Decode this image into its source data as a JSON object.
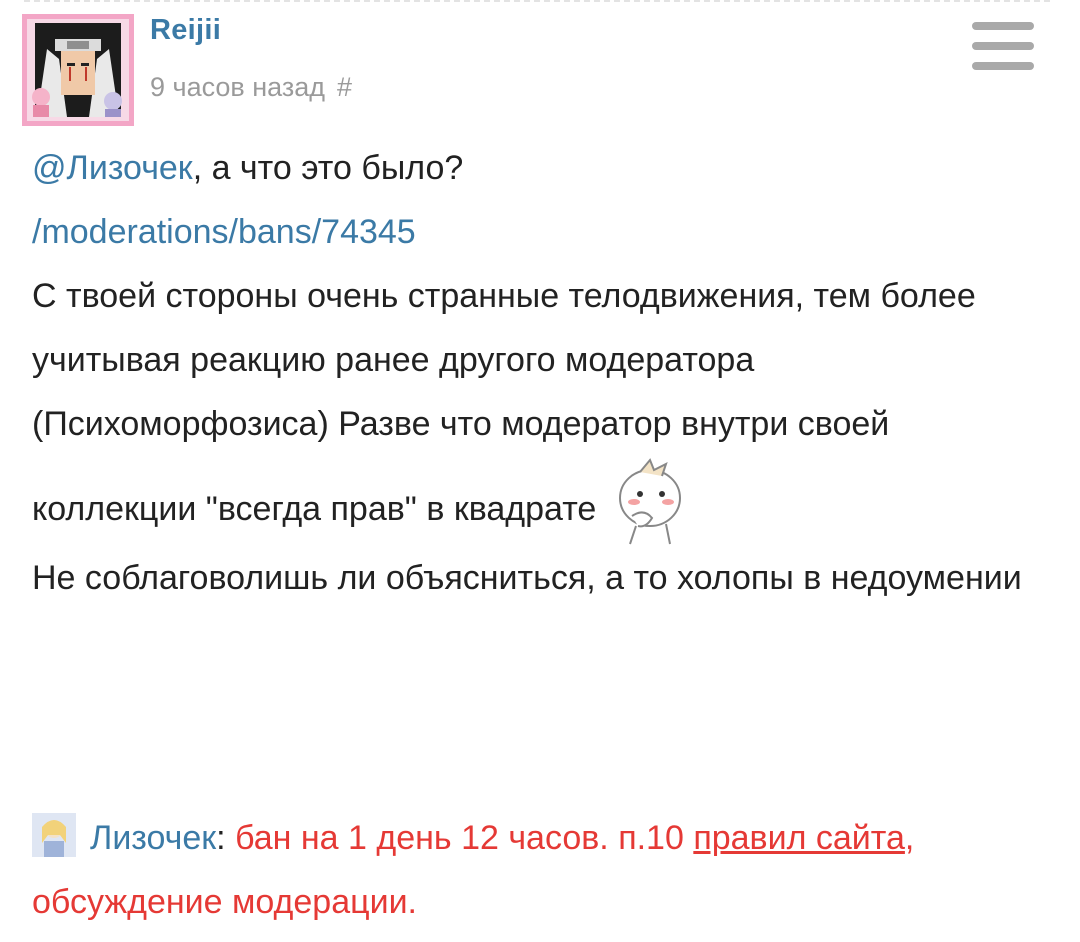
{
  "post": {
    "author": "Reijii",
    "time": "9 часов назад",
    "permalink_symbol": "#",
    "mention": "@Лизочек",
    "line1_rest": ", а что это было?",
    "link": "/moderations/bans/74345",
    "paragraph": "С твоей стороны очень странные телодвижения, тем более учитывая реакцию ранее другого модератора (Психоморфозиса) Разве что модератор внутри своей коллекции \"всегда прав\" в квадрате",
    "paragraph2": "Не соблаговолишь ли объясниться, а то холопы в недоумении",
    "emoji": "thinking-blush-emoji"
  },
  "moderation": {
    "moderator": "Лизочек",
    "colon": ":",
    "ban_text": " бан на 1 день 12 часов. п.10 ",
    "rules_link": "правил сайта",
    "comma": ",",
    "discussion_link": "обсуждение модерации."
  },
  "colors": {
    "link": "#3b7aa6",
    "ban": "#e53935",
    "muted": "#9a9a9a",
    "text": "#222222"
  }
}
